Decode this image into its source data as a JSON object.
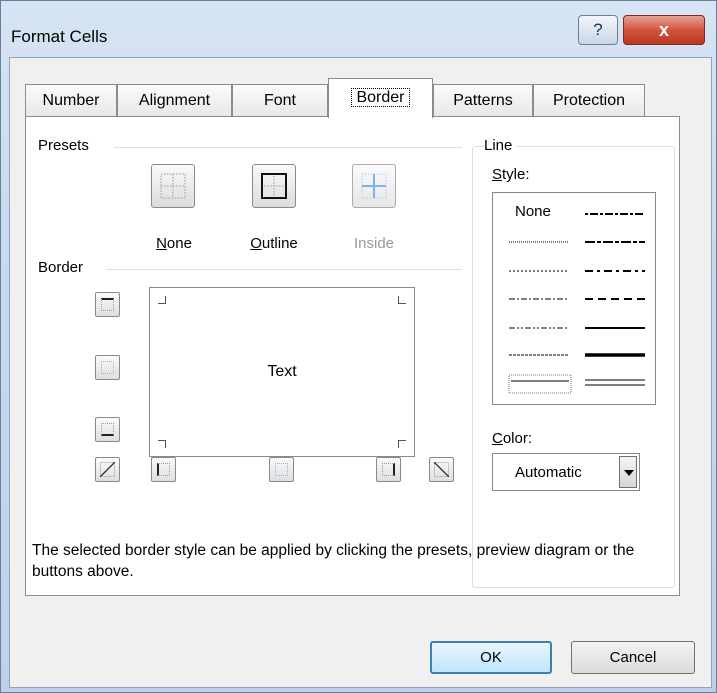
{
  "window": {
    "title": "Format Cells",
    "help_glyph": "?",
    "close_glyph": "x"
  },
  "tabs": [
    {
      "label": "Number"
    },
    {
      "label": "Alignment"
    },
    {
      "label": "Font"
    },
    {
      "label": "Border",
      "active": true
    },
    {
      "label": "Patterns"
    },
    {
      "label": "Protection"
    }
  ],
  "presets": {
    "group_label": "Presets",
    "items": [
      {
        "label_key": "N",
        "label_rest": "one",
        "enabled": true
      },
      {
        "label_key": "O",
        "label_rest": "utline",
        "enabled": true
      },
      {
        "label_key": "",
        "label_rest": "Inside",
        "enabled": false
      }
    ]
  },
  "border": {
    "group_label": "Border",
    "preview_text": "Text"
  },
  "line": {
    "group_label": "Line",
    "style_label_key": "S",
    "style_label_rest": "tyle:",
    "none_label": "None",
    "color_label_key": "C",
    "color_label_rest": "olor:",
    "color_value": "Automatic"
  },
  "hint": "The selected border style can be applied by clicking the presets, preview diagram or the buttons above.",
  "buttons": {
    "ok": "OK",
    "cancel": "Cancel"
  },
  "colors": {
    "accent_blue": "#4a90e2",
    "close_red": "#c9452d",
    "panel_bg": "#f0f0f0"
  }
}
